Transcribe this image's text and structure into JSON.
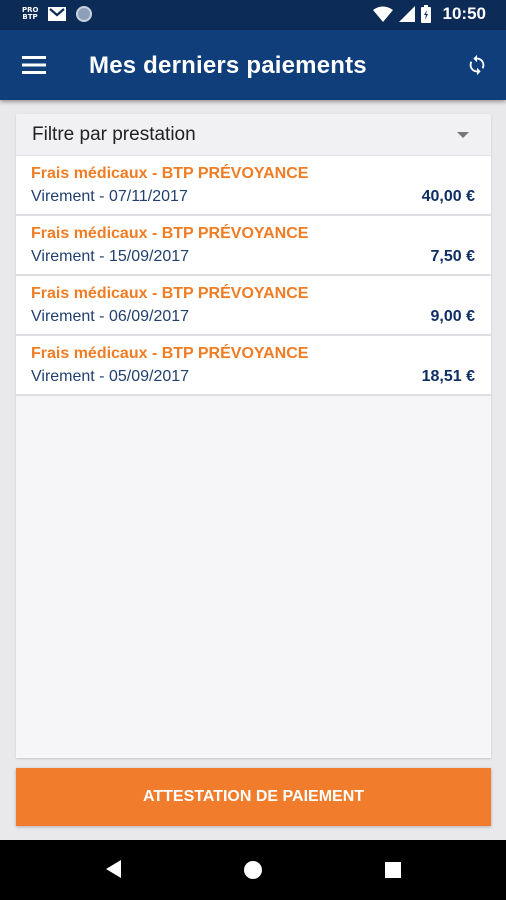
{
  "status_bar": {
    "app_badge": "PRO\nBTP",
    "time": "10:50",
    "icons": [
      "probtp-app-icon",
      "gmail-icon",
      "circle-app-icon",
      "wifi-icon",
      "signal-icon",
      "battery-icon"
    ]
  },
  "app_bar": {
    "title": "Mes derniers paiements",
    "menu_icon": "hamburger-menu-icon",
    "refresh_icon": "refresh-icon"
  },
  "filter": {
    "label": "Filtre par prestation"
  },
  "payments": [
    {
      "title": "Frais médicaux - BTP PRÉVOYANCE",
      "subtitle": "Virement - 07/11/2017",
      "amount": "40,00 €"
    },
    {
      "title": "Frais médicaux - BTP PRÉVOYANCE",
      "subtitle": "Virement - 15/09/2017",
      "amount": "7,50 €"
    },
    {
      "title": "Frais médicaux - BTP PRÉVOYANCE",
      "subtitle": "Virement - 06/09/2017",
      "amount": "9,00 €"
    },
    {
      "title": "Frais médicaux - BTP PRÉVOYANCE",
      "subtitle": "Virement - 05/09/2017",
      "amount": "18,51 €"
    }
  ],
  "actions": {
    "attestation_label": "ATTESTATION DE PAIEMENT"
  },
  "colors": {
    "header_blue": "#0f3e7a",
    "status_blue": "#0d2b57",
    "accent_orange": "#f07c2c",
    "amount_navy": "#0f2e63"
  }
}
